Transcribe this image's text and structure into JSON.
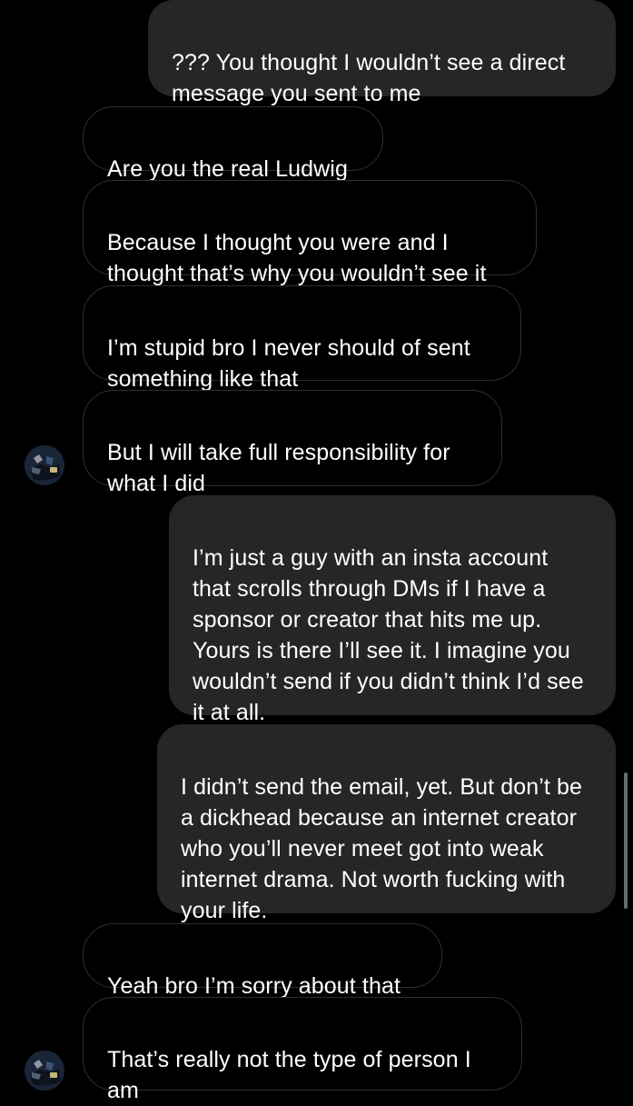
{
  "conversation": {
    "messages": [
      {
        "sender": "self",
        "text": "??? You thought I wouldn’t see a direct message you sent to me"
      },
      {
        "sender": "other",
        "text": "Are you the real Ludwig"
      },
      {
        "sender": "other",
        "text": "Because I thought you were and I thought that’s why you wouldn’t see it"
      },
      {
        "sender": "other",
        "text": "I’m stupid bro I never should of sent something like that"
      },
      {
        "sender": "other",
        "text": "But I will take full responsibility for what I did"
      },
      {
        "sender": "self",
        "text": "I’m just a guy with an insta account that scrolls through DMs if I have a sponsor or creator that hits me up. Yours is there I’ll see it. I imagine you wouldn’t send if you didn’t think I’d see it at all."
      },
      {
        "sender": "self",
        "text": "I didn’t send the email, yet. But don’t be a dickhead because an internet creator who you’ll never meet got into weak internet drama. Not worth fucking with your life."
      },
      {
        "sender": "other",
        "text": "Yeah bro I’m sorry about that"
      },
      {
        "sender": "other",
        "text": "That’s really not the type of person I am"
      }
    ]
  },
  "colors": {
    "background": "#000000",
    "sent_bubble": "#262626",
    "received_border": "#2f2f2f",
    "text": "#ffffff"
  },
  "icons": {
    "avatar": "profile-avatar-icon"
  }
}
